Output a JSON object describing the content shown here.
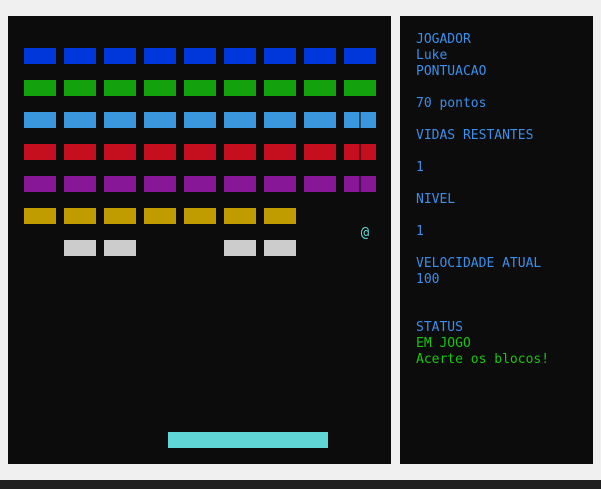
{
  "colors": {
    "row_1": "#0037da",
    "row_2": "#13a10e",
    "row_3": "#3a96dd",
    "row_4": "#c50f1f",
    "row_5": "#881798",
    "row_6": "#c19c00",
    "row_7": "#cccccc",
    "paddle": "#61d6d6",
    "hud_text": "#3b8eea",
    "status_text": "#16c60c"
  },
  "game": {
    "ball_glyph": "@",
    "rows": [
      {
        "color": "#0037da",
        "bricks": [
          true,
          true,
          true,
          true,
          true,
          true,
          true,
          true,
          true
        ]
      },
      {
        "color": "#13a10e",
        "bricks": [
          true,
          true,
          true,
          true,
          true,
          true,
          true,
          true,
          true
        ]
      },
      {
        "color": "#3a96dd",
        "bricks": [
          true,
          true,
          true,
          true,
          true,
          true,
          true,
          true,
          true
        ],
        "last_split": true
      },
      {
        "color": "#c50f1f",
        "bricks": [
          true,
          true,
          true,
          true,
          true,
          true,
          true,
          true,
          true
        ],
        "last_split": true
      },
      {
        "color": "#881798",
        "bricks": [
          true,
          true,
          true,
          true,
          true,
          true,
          true,
          true,
          true
        ],
        "last_split": true
      },
      {
        "color": "#c19c00",
        "bricks": [
          true,
          true,
          true,
          true,
          true,
          true,
          true,
          false,
          false
        ]
      },
      {
        "color": "#cccccc",
        "bricks": [
          false,
          true,
          true,
          false,
          false,
          true,
          true,
          false,
          false
        ]
      }
    ]
  },
  "hud": {
    "player_label": "JOGADOR",
    "player_name": "Luke",
    "score_label": "PONTUACAO",
    "score_value": "70 pontos",
    "lives_label": "VIDAS RESTANTES",
    "lives_value": "1",
    "level_label": "NIVEL",
    "level_value": "1",
    "speed_label": "VELOCIDADE ATUAL",
    "speed_value": "100",
    "status_label": "STATUS",
    "status_value": "EM JOGO",
    "status_message": "Acerte os blocos!"
  }
}
